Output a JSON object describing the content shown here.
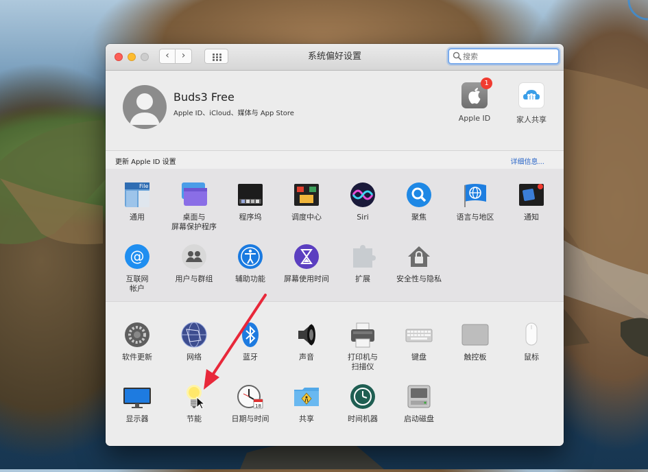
{
  "window": {
    "title": "系统偏好设置"
  },
  "search": {
    "placeholder": "搜索"
  },
  "profile": {
    "name": "Buds3 Free",
    "subtitle": "Apple ID、iCloud、媒体与 App Store",
    "apple_id_label": "Apple ID",
    "apple_id_badge": "1",
    "family_label": "家人共享"
  },
  "notice": {
    "text": "更新 Apple ID 设置",
    "link": "详细信息..."
  },
  "row1": [
    {
      "name": "general",
      "label": "通用",
      "icon": "general-icon"
    },
    {
      "name": "desktop-screensaver",
      "label": "桌面与\n屏幕保护程序",
      "icon": "desktop-icon"
    },
    {
      "name": "dock",
      "label": "程序坞",
      "icon": "dock-icon"
    },
    {
      "name": "mission-control",
      "label": "调度中心",
      "icon": "mission-control-icon"
    },
    {
      "name": "siri",
      "label": "Siri",
      "icon": "siri-icon"
    },
    {
      "name": "spotlight",
      "label": "聚焦",
      "icon": "spotlight-icon"
    },
    {
      "name": "language-region",
      "label": "语言与地区",
      "icon": "globe-flag-icon"
    },
    {
      "name": "notifications",
      "label": "通知",
      "icon": "notifications-icon"
    }
  ],
  "row2": [
    {
      "name": "internet-accounts",
      "label": "互联网\n帐户",
      "icon": "at-sign-icon"
    },
    {
      "name": "users-groups",
      "label": "用户与群组",
      "icon": "users-icon"
    },
    {
      "name": "accessibility",
      "label": "辅助功能",
      "icon": "accessibility-icon"
    },
    {
      "name": "screen-time",
      "label": "屏幕使用时间",
      "icon": "hourglass-icon"
    },
    {
      "name": "extensions",
      "label": "扩展",
      "icon": "puzzle-icon"
    },
    {
      "name": "security-privacy",
      "label": "安全性与隐私",
      "icon": "house-lock-icon"
    }
  ],
  "row3": [
    {
      "name": "software-update",
      "label": "软件更新",
      "icon": "gear-icon"
    },
    {
      "name": "network",
      "label": "网络",
      "icon": "network-globe-icon"
    },
    {
      "name": "bluetooth",
      "label": "蓝牙",
      "icon": "bluetooth-icon"
    },
    {
      "name": "sound",
      "label": "声音",
      "icon": "speaker-icon"
    },
    {
      "name": "printers-scanners",
      "label": "打印机与\n扫描仪",
      "icon": "printer-icon"
    },
    {
      "name": "keyboard",
      "label": "键盘",
      "icon": "keyboard-icon"
    },
    {
      "name": "trackpad",
      "label": "触控板",
      "icon": "trackpad-icon"
    },
    {
      "name": "mouse",
      "label": "鼠标",
      "icon": "mouse-icon"
    }
  ],
  "row4": [
    {
      "name": "displays",
      "label": "显示器",
      "icon": "display-icon"
    },
    {
      "name": "energy-saver",
      "label": "节能",
      "icon": "lightbulb-icon"
    },
    {
      "name": "date-time",
      "label": "日期与时间",
      "icon": "clock-calendar-icon"
    },
    {
      "name": "sharing",
      "label": "共享",
      "icon": "folder-sharing-icon"
    },
    {
      "name": "time-machine",
      "label": "时间机器",
      "icon": "time-machine-icon"
    },
    {
      "name": "startup-disk",
      "label": "启动磁盘",
      "icon": "disk-icon"
    }
  ],
  "date_icon_day": "18",
  "colors": {
    "accent": "#2a66c8",
    "annotation_arrow": "#e8283a",
    "badge": "#f03b30"
  }
}
